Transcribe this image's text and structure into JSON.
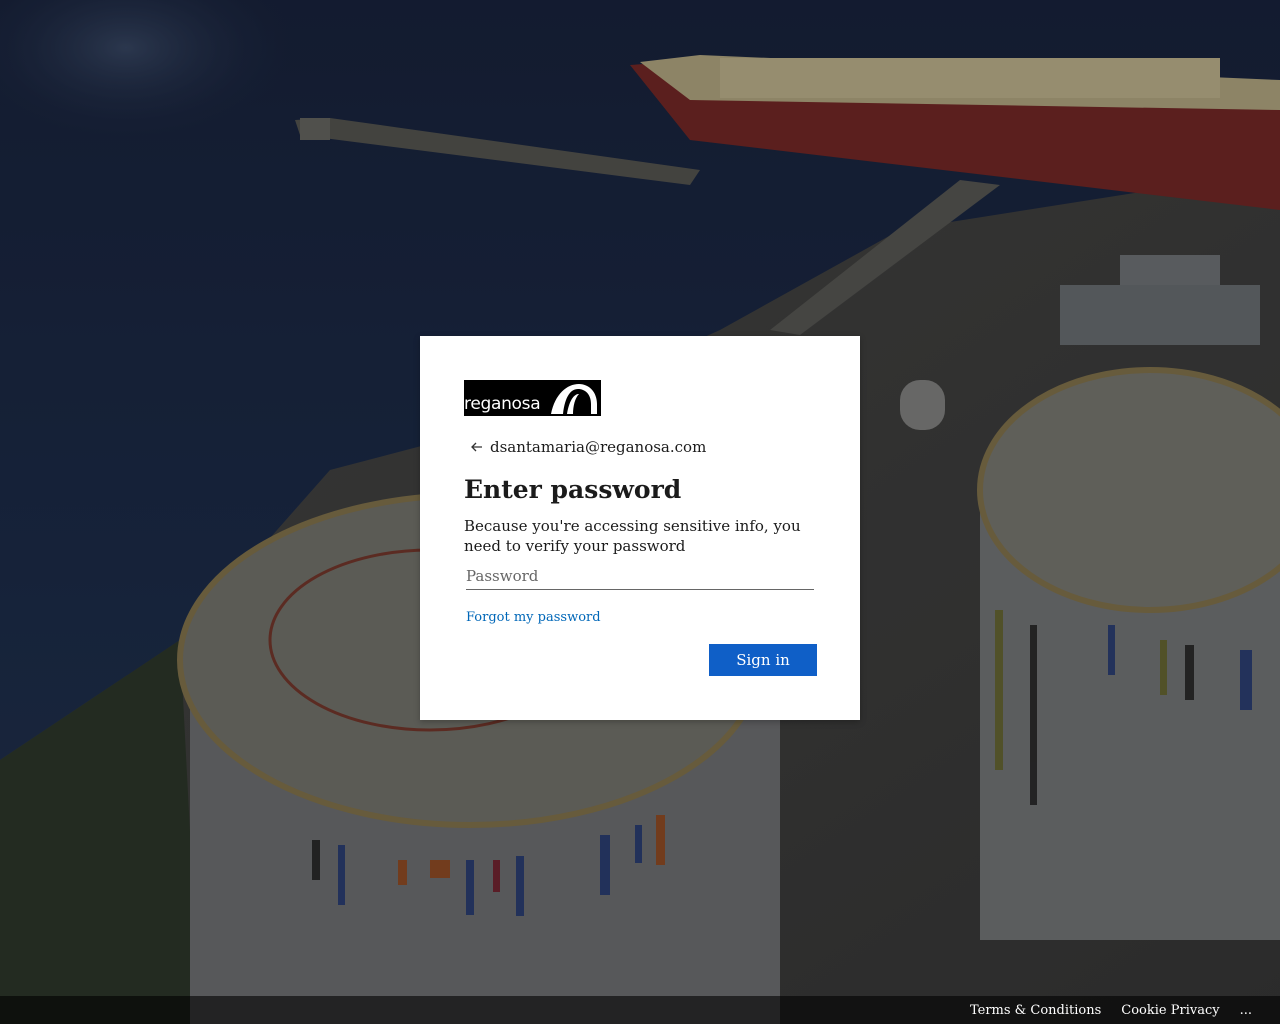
{
  "brand": {
    "logo_text": "reganosa"
  },
  "signin": {
    "identity": "dsantamaria@reganosa.com",
    "title": "Enter password",
    "description": "Because you're accessing sensitive info, you need to verify your password",
    "password_placeholder": "Password",
    "forgot_link": "Forgot my password",
    "submit_label": "Sign in"
  },
  "footer": {
    "terms": "Terms & Conditions",
    "privacy": "Cookie Privacy",
    "more": "..."
  },
  "colors": {
    "accent": "#0f5fc7",
    "link": "#0067b8",
    "card_bg": "#ffffff",
    "logo_bg": "#000000"
  },
  "icons": {
    "back": "arrow-left-icon",
    "logo_mark": "reganosa-arch-logo"
  }
}
